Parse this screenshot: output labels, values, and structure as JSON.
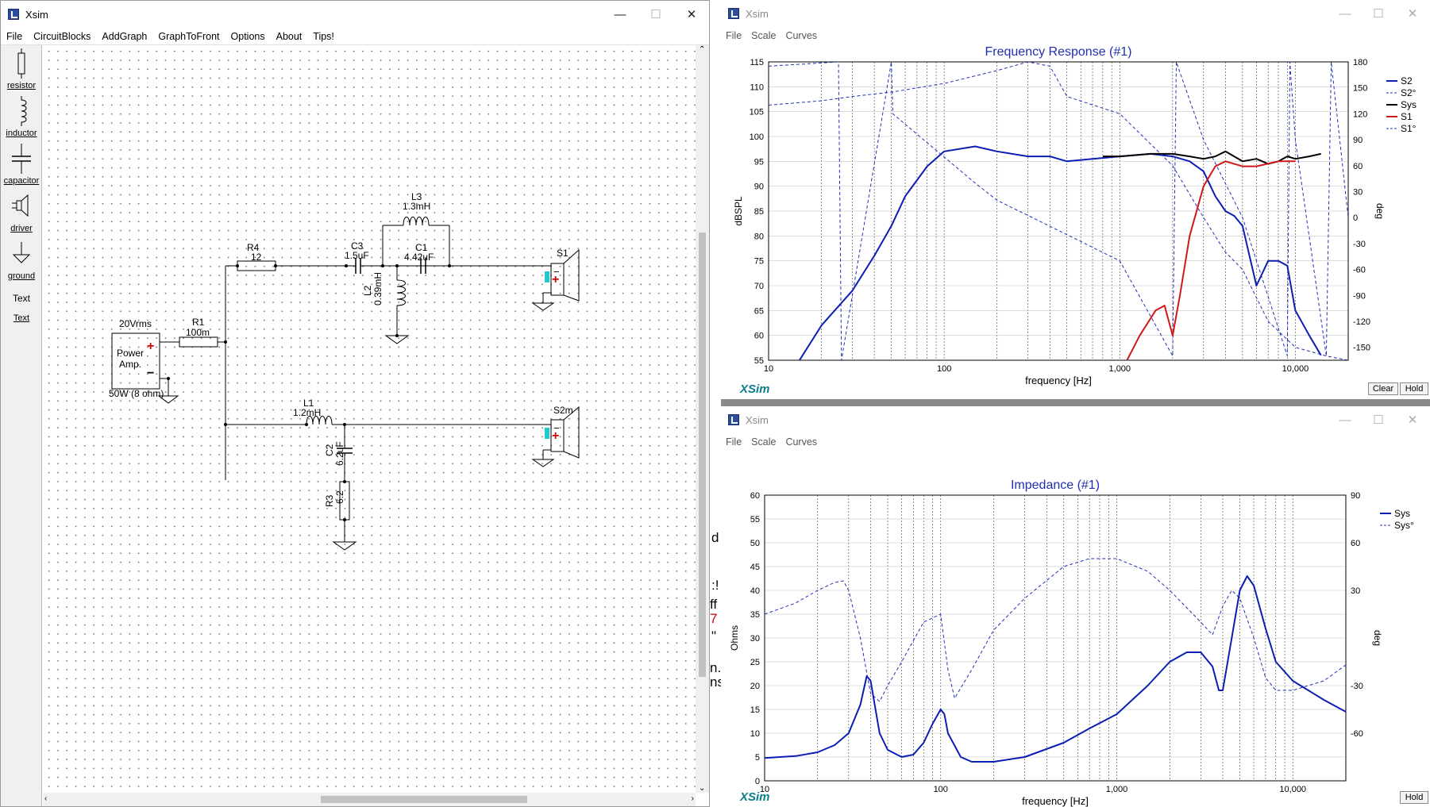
{
  "circuit_window": {
    "title": "Xsim",
    "menu": [
      "File",
      "CircuitBlocks",
      "AddGraph",
      "GraphToFront",
      "Options",
      "About",
      "Tips!"
    ],
    "tools": [
      {
        "icon": "resistor-icon",
        "label": "resistor"
      },
      {
        "icon": "inductor-icon",
        "label": "inductor"
      },
      {
        "icon": "capacitor-icon",
        "label": "capacitor"
      },
      {
        "icon": "driver-icon",
        "label": "driver"
      },
      {
        "icon": "ground-icon",
        "label": "ground"
      },
      {
        "icon": "text-icon",
        "label": "Text",
        "glyph": "Text"
      },
      {
        "icon": "text-link",
        "label": "Text"
      }
    ],
    "schematic": {
      "amp_voltage": "20Vrms",
      "amp_name_1": "Power",
      "amp_name_2": "Amp.",
      "amp_power": "50W (8 ohm)",
      "r1": {
        "name": "R1",
        "value": "100m"
      },
      "r4": {
        "name": "R4",
        "value": "12"
      },
      "c3": {
        "name": "C3",
        "value": "1.5uF"
      },
      "l3": {
        "name": "L3",
        "value": "1.3mH"
      },
      "c1": {
        "name": "C1",
        "value": "4.42uF"
      },
      "l2": {
        "name": "L2",
        "value": "0.39mH"
      },
      "s1": "S1",
      "l1": {
        "name": "L1",
        "value": "1.2mH"
      },
      "s2": "S2m",
      "c2": {
        "name": "C2",
        "value": "6.2uF"
      },
      "r3": {
        "name": "R3",
        "value": "6.2"
      }
    }
  },
  "freq_window": {
    "title": "Xsim",
    "menu": [
      "File",
      "Scale",
      "Curves"
    ],
    "brand": "XSim",
    "clear_label": "Clear",
    "hold_label": "Hold",
    "chart_data": {
      "type": "line",
      "title": "Frequency Response (#1)",
      "xlabel": "frequency [Hz]",
      "ylabel": "dBSPL",
      "y2label": "deg",
      "xscale": "log",
      "xlim": [
        10,
        20000
      ],
      "ylim": [
        55,
        115
      ],
      "y2lim": [
        -165,
        180
      ],
      "x_ticks": [
        "10",
        "100",
        "1,000",
        "10,000"
      ],
      "y_ticks": [
        "55",
        "60",
        "65",
        "70",
        "75",
        "80",
        "85",
        "90",
        "95",
        "100",
        "105",
        "110",
        "115"
      ],
      "y2_ticks": [
        "180",
        "150",
        "120",
        "90",
        "60",
        "30",
        "0",
        "-30",
        "-60",
        "-90",
        "-120",
        "-150"
      ],
      "grid": true,
      "legend": "right",
      "series": [
        {
          "name": "S2",
          "color": "#0a1eb4",
          "style": "solid",
          "x": [
            15,
            20,
            30,
            40,
            50,
            60,
            80,
            100,
            150,
            200,
            300,
            400,
            500,
            700,
            1000,
            1500,
            2000,
            2500,
            3000,
            3500,
            4000,
            4500,
            5000,
            6000,
            7000,
            8000,
            9000,
            10000,
            12000,
            14000
          ],
          "y": [
            55,
            62,
            69,
            76,
            82,
            88,
            94,
            97,
            98,
            97,
            96,
            96,
            95,
            95.5,
            96,
            96.5,
            96,
            95,
            93,
            88,
            85,
            84,
            82,
            70,
            75,
            75,
            74,
            65,
            60,
            56
          ]
        },
        {
          "name": "S2°",
          "color": "#2030b8",
          "style": "dashed",
          "x": [
            10,
            25,
            26,
            50,
            51,
            100,
            150,
            200,
            400,
            1000,
            2000,
            2100,
            3000,
            5000,
            9000,
            9300,
            10000,
            15000,
            16000,
            20000
          ],
          "y": [
            175,
            180,
            -165,
            180,
            120,
            70,
            40,
            20,
            -10,
            -50,
            -160,
            180,
            90,
            0,
            -160,
            180,
            90,
            -160,
            180,
            0
          ]
        },
        {
          "name": "Sys",
          "color": "#000000",
          "style": "solid",
          "x": [
            800,
            1000,
            1500,
            2000,
            2500,
            3000,
            3500,
            4000,
            5000,
            6000,
            7000,
            8000,
            9000,
            10000,
            12000,
            14000
          ],
          "y": [
            96,
            96,
            96.5,
            96.5,
            96,
            95.5,
            96,
            97,
            95,
            95.5,
            94.5,
            95,
            96,
            95.5,
            96,
            96.5
          ]
        },
        {
          "name": "S1",
          "color": "#d01818",
          "style": "solid",
          "x": [
            1100,
            1300,
            1600,
            1800,
            2000,
            2200,
            2500,
            3000,
            3500,
            4000,
            5000,
            6000,
            8000,
            10000
          ],
          "y": [
            55,
            60,
            65,
            66,
            60,
            68,
            80,
            90,
            94,
            95,
            94,
            94,
            95,
            95
          ]
        },
        {
          "name": "S1°",
          "color": "#2030b8",
          "style": "dashed",
          "x": [
            10,
            20,
            30,
            50,
            100,
            200,
            300,
            400,
            500,
            1000,
            2000,
            3000,
            4000,
            5000,
            7000,
            10000,
            15000,
            20000
          ],
          "y": [
            130,
            135,
            140,
            145,
            155,
            170,
            180,
            175,
            140,
            120,
            60,
            0,
            -40,
            -60,
            -120,
            -150,
            -160,
            -165
          ]
        }
      ]
    }
  },
  "imp_window": {
    "title": "Xsim",
    "menu": [
      "File",
      "Scale",
      "Curves"
    ],
    "brand": "XSim",
    "hold_label": "Hold",
    "chart_data": {
      "type": "line",
      "title": "Impedance (#1)",
      "xlabel": "frequency [Hz]",
      "ylabel": "Ohms",
      "y2label": "deg",
      "xscale": "log",
      "xlim": [
        10,
        20000
      ],
      "ylim": [
        0,
        60
      ],
      "y2lim": [
        -90,
        90
      ],
      "x_ticks": [
        "10",
        "100",
        "1,000",
        "10,000"
      ],
      "y_ticks": [
        "0",
        "5",
        "10",
        "15",
        "20",
        "25",
        "30",
        "35",
        "40",
        "45",
        "50",
        "55",
        "60"
      ],
      "y2_ticks": [
        "90",
        "60",
        "30",
        "-30",
        "-60"
      ],
      "grid": true,
      "legend": "top-right",
      "series": [
        {
          "name": "Sys",
          "color": "#0a1eb4",
          "style": "solid",
          "x": [
            10,
            15,
            20,
            25,
            30,
            35,
            38,
            40,
            45,
            50,
            60,
            70,
            80,
            90,
            100,
            105,
            110,
            130,
            150,
            200,
            300,
            500,
            700,
            1000,
            1500,
            2000,
            2500,
            3000,
            3500,
            3800,
            4000,
            4500,
            5000,
            5500,
            6000,
            7000,
            8000,
            10000,
            15000,
            20000
          ],
          "y": [
            4.8,
            5.2,
            6,
            7.5,
            10,
            16,
            22,
            21,
            10,
            6.5,
            5,
            5.5,
            8,
            12,
            15,
            14,
            10,
            5,
            4,
            4,
            5,
            8,
            11,
            14,
            20,
            25,
            27,
            27,
            24,
            19,
            19,
            30,
            40,
            43,
            41,
            32,
            25,
            21,
            17,
            14.5
          ]
        },
        {
          "name": "Sys°",
          "color": "#2030b8",
          "style": "dashed",
          "x": [
            10,
            15,
            20,
            25,
            28,
            30,
            35,
            40,
            45,
            50,
            60,
            80,
            100,
            110,
            120,
            150,
            200,
            300,
            500,
            700,
            1000,
            1500,
            2000,
            3000,
            3500,
            4000,
            4500,
            5000,
            6000,
            7000,
            8000,
            10000,
            15000,
            20000
          ],
          "y": [
            15,
            22,
            30,
            35,
            36,
            30,
            0,
            -35,
            -40,
            -30,
            -15,
            10,
            15,
            -20,
            -38,
            -20,
            5,
            25,
            45,
            50,
            50,
            42,
            30,
            10,
            2,
            20,
            30,
            25,
            0,
            -25,
            -33,
            -33,
            -27,
            -17
          ]
        }
      ]
    }
  },
  "background_text": [
    "d",
    "ff",
    "\"",
    "n.",
    "ns",
    ":!",
    "7"
  ]
}
